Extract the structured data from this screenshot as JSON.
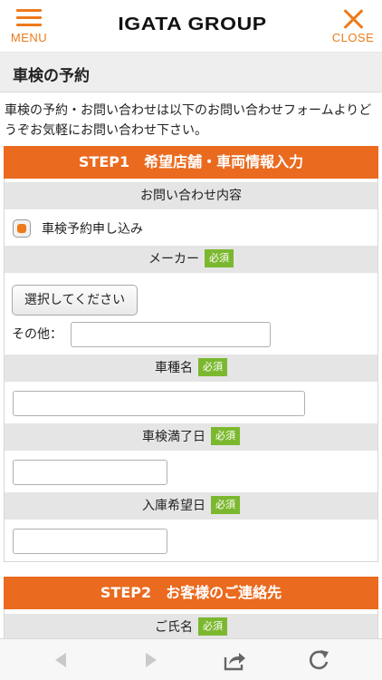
{
  "header": {
    "menu_label": "MENU",
    "logo": "IGATA GROUP",
    "close_label": "CLOSE",
    "accent_color": "#ee7a1a"
  },
  "page": {
    "title": "車検の予約",
    "intro": "車検の予約・お問い合わせは以下のお問い合わせフォームよりどうぞお気軽にお問い合わせ下さい。"
  },
  "step1": {
    "title": "STEP1　希望店舗・車両情報入力",
    "color": "#ea6a1f",
    "inquiry_header": "お問い合わせ内容",
    "inquiry_option": "車検予約申し込み",
    "inquiry_selected": true,
    "maker_label": "メーカー",
    "maker_select": "選択してください",
    "other_label": "その他：",
    "other_value": "",
    "model_label": "車種名",
    "model_value": "",
    "expiry_label": "車検満了日",
    "expiry_value": "",
    "entry_label": "入庫希望日",
    "entry_value": ""
  },
  "step2": {
    "title": "STEP2　お客様のご連絡先",
    "name_label": "ご氏名"
  },
  "required_label": "必須",
  "required_color": "#7cb82f",
  "toolbar": {
    "icons": [
      "back-icon",
      "forward-icon",
      "share-icon",
      "reload-icon"
    ]
  }
}
